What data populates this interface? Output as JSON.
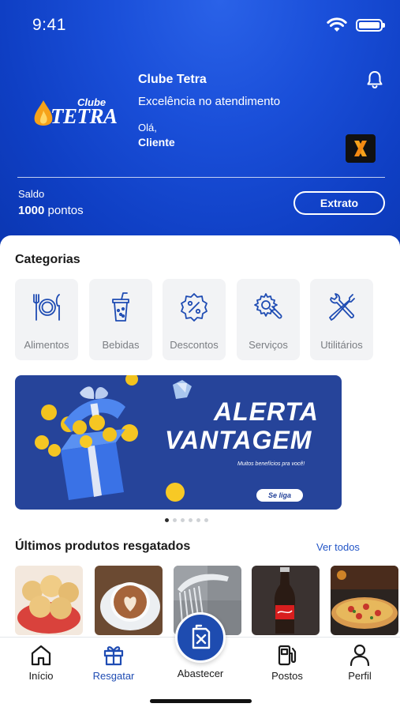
{
  "status_bar": {
    "time": "9:41"
  },
  "header": {
    "logo": {
      "small": "Clube",
      "big": "TETRA"
    },
    "club_title": "Clube Tetra",
    "club_subtitle": "Excelência no atendimento",
    "greeting": "Olá,",
    "user_name": "Cliente",
    "saldo_label": "Saldo",
    "saldo_amount": "1000",
    "saldo_unit": "pontos",
    "extrato_label": "Extrato"
  },
  "categories": {
    "title": "Categorias",
    "items": [
      {
        "label": "Alimentos",
        "icon": "fork-knife-plate-icon"
      },
      {
        "label": "Bebidas",
        "icon": "drink-cup-icon"
      },
      {
        "label": "Descontos",
        "icon": "percent-badge-icon"
      },
      {
        "label": "Serviços",
        "icon": "gear-wrench-icon"
      },
      {
        "label": "Utilitários",
        "icon": "tools-icon"
      }
    ]
  },
  "banner": {
    "title_line1": "ALERTA",
    "title_line2": "VANTAGEM",
    "subtitle": "Muitos benefícios pra você!",
    "cta": "Se liga",
    "dot_count": 6,
    "active_dot": 0
  },
  "recent": {
    "title": "Últimos produtos resgatados",
    "see_all": "Ver todos",
    "products": [
      {
        "icon": "cheese-bread-image"
      },
      {
        "icon": "cappuccino-image"
      },
      {
        "icon": "shower-image"
      },
      {
        "icon": "coca-cola-bottle-image"
      },
      {
        "icon": "pizza-image"
      }
    ]
  },
  "tabbar": {
    "items": [
      {
        "label": "Início",
        "icon": "home-icon",
        "active": false
      },
      {
        "label": "Resgatar",
        "icon": "gift-icon",
        "active": true
      },
      {
        "label": "Abastecer",
        "icon": "fuel-can-icon",
        "active": false
      },
      {
        "label": "Postos",
        "icon": "gas-station-icon",
        "active": false
      },
      {
        "label": "Perfil",
        "icon": "user-icon",
        "active": false
      }
    ]
  },
  "colors": {
    "primary": "#1a4fd9",
    "accent": "#1e4cb0",
    "banner": "#26449a",
    "link": "#2356c7"
  }
}
